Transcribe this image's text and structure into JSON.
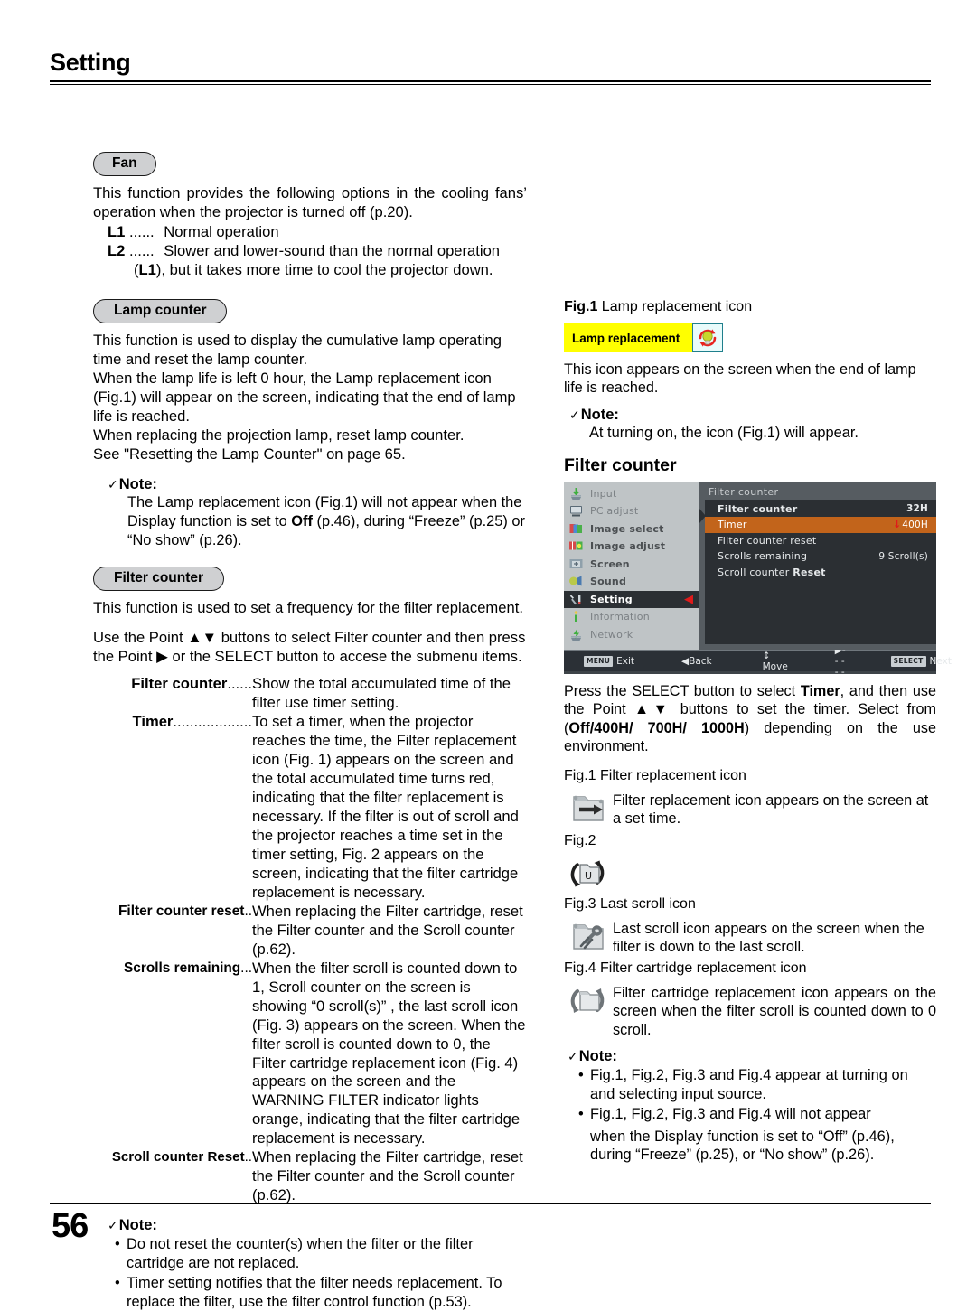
{
  "header": {
    "title": "Setting"
  },
  "footer": {
    "page_number": "56"
  },
  "left": {
    "fan": {
      "pill": "Fan",
      "intro": "This function provides the following options in the cooling fans’ operation when the projector is turned off (p.20).",
      "options": [
        {
          "key": "L1",
          "dots": "......",
          "desc": "Normal operation"
        },
        {
          "key": "L2",
          "dots": "......",
          "desc": "Slower and lower-sound than the normal operation",
          "desc2_pre": "(",
          "desc2_bold": "L1",
          "desc2_post": "), but it takes more time to cool the projector down."
        }
      ]
    },
    "lamp_counter": {
      "pill": "Lamp counter",
      "para1": "This function is used to display the cumulative lamp operating time and reset the lamp counter.",
      "para2": "When the lamp life is left 0 hour, the Lamp replacement icon (Fig.1) will appear on the screen, indicating that the end of lamp life is reached.",
      "para3": "When replacing the projection lamp, reset lamp counter.",
      "para4": "See \"Resetting the Lamp Counter\" on page 65.",
      "note_label": "Note:",
      "note_text_pre": "The Lamp replacement icon (Fig.1) will not appear when the Display function is set to ",
      "note_text_bold": "Off",
      "note_text_post": " (p.46), during “Freeze” (p.25) or “No show” (p.26)."
    },
    "filter_counter": {
      "pill": "Filter counter",
      "para1": "This function is used to set a frequency for the filter replacement.",
      "para2_a": "Use the Point ",
      "para2_arrows": "▲▼",
      "para2_b": " buttons to select Filter counter and then press the Point ",
      "para2_arrow_right": "▶",
      "para2_c": " or the SELECT button to accese the submenu items.",
      "definitions": [
        {
          "term": "Filter counter",
          "dots": "......",
          "desc": "Show the total accumulated time of the filter use timer setting."
        },
        {
          "term": "Timer",
          "dots": "...................",
          "desc": "To set a timer, when the projector reaches the time, the Filter replacement icon (Fig. 1) appears on the screen and the total accumulated time turns red, indicating that the filter replacement is necessary. If the filter is out of scroll and the projector reaches a time set in the timer setting, Fig. 2 appears on the screen, indicating that the filter cartridge replacement is necessary."
        },
        {
          "term": "Filter counter reset",
          "dots": "..",
          "desc": "When replacing the Filter cartridge, reset the Filter counter and the Scroll counter (p.62)."
        },
        {
          "term": "Scrolls remaining",
          "dots": "...",
          "desc": "When the filter scroll is counted down to 1, Scroll counter on the screen is showing “0 scroll(s)” , the last scroll icon (Fig. 3) appears on the screen. When the filter scroll is counted down to 0, the Filter cartridge replacement icon (Fig. 4) appears on the screen and the WARNING FILTER indicator lights orange, indicating that the filter cartridge replacement is necessary."
        },
        {
          "term": "Scroll counter Reset",
          "dots": "..",
          "desc": "When replacing the Filter cartridge, reset the Filter counter and the Scroll counter (p.62)."
        }
      ],
      "note_label": "Note:",
      "note_bullets": [
        "Do not reset the counter(s) when the filter or the filter cartridge are not replaced.",
        "Timer setting notifies that the filter needs replacement. To replace the filter, use the filter control function (p.53)."
      ]
    }
  },
  "right": {
    "fig1_lamp": {
      "label_bold": "Fig.1",
      "label_rest": "  Lamp replacement icon",
      "banner_text": "Lamp replacement",
      "banner_icon": "lamp-replacement-icon",
      "caption": "This icon appears on the screen when the end of lamp life is reached.",
      "note_label": "Note:",
      "note_text": "At turning on, the icon (Fig.1) will appear."
    },
    "filter_counter_section": {
      "title": "Filter counter",
      "osd": {
        "sidebar": [
          {
            "label": "Input",
            "icon": "input-icon",
            "state": "dim"
          },
          {
            "label": "PC adjust",
            "icon": "pc-adjust-icon",
            "state": "dim"
          },
          {
            "label": "Image select",
            "icon": "image-select-icon",
            "state": "bright"
          },
          {
            "label": "Image adjust",
            "icon": "image-adjust-icon",
            "state": "bright"
          },
          {
            "label": "Screen",
            "icon": "screen-icon",
            "state": "bright"
          },
          {
            "label": "Sound",
            "icon": "sound-icon",
            "state": "bright"
          },
          {
            "label": "Setting",
            "icon": "setting-icon",
            "state": "active"
          },
          {
            "label": "Information",
            "icon": "information-icon",
            "state": "dim"
          },
          {
            "label": "Network",
            "icon": "network-icon",
            "state": "dim"
          }
        ],
        "panel_title": "Filter counter",
        "rows": [
          {
            "name": "Filter counter",
            "value": "32H",
            "selected": false,
            "bold": true
          },
          {
            "name": "Timer",
            "value": "400H",
            "selected": true,
            "arrow": "↓"
          },
          {
            "name": "Filter  counter  reset",
            "value": "",
            "selected": false
          },
          {
            "name": "Scrolls remaining",
            "value": "9 Scroll(s)",
            "selected": false
          },
          {
            "name": "Scroll counter ",
            "name_bold": "Reset",
            "value": "",
            "selected": false
          }
        ],
        "bar": [
          {
            "key": "MENU",
            "label": "Exit"
          },
          {
            "key": "",
            "label": "◀Back"
          },
          {
            "key": "",
            "label": "↕ Move"
          },
          {
            "key": "",
            "label": "▶- - - - -"
          },
          {
            "key": "SELECT",
            "label": "Next"
          }
        ]
      },
      "instruction_a": "Press the SELECT button to select ",
      "instruction_timer": "Timer",
      "instruction_b": ", and then use the Point ",
      "instruction_arrows": "▲▼",
      "instruction_c": " buttons to set the timer. Select from (",
      "instruction_opts1": "Off/",
      "instruction_opts2": "400H/ 700H/ 1000H",
      "instruction_d": ") depending on the use environment."
    },
    "figures": [
      {
        "label": "Fig.1 Filter replacement icon",
        "icon": "filter-replacement-icon",
        "text": "Filter replacement icon appears on the screen at a set time."
      },
      {
        "label": "Fig.2",
        "icon": "filter-cartridge-u-icon",
        "text": ""
      },
      {
        "label": "Fig.3 Last scroll icon",
        "icon": "last-scroll-icon",
        "text": "Last scroll icon appears on the screen when the filter is down to the last scroll."
      },
      {
        "label": "Fig.4 Filter cartridge replacement icon",
        "icon": "filter-cartridge-replacement-icon",
        "text": "Filter cartridge replacement icon appears on the screen when the filter scroll is counted down to 0 scroll."
      }
    ],
    "final_note": {
      "note_label": "Note:",
      "bullets": [
        "Fig.1, Fig.2, Fig.3 and Fig.4 appear at turning on and selecting input source.",
        "Fig.1, Fig.2, Fig.3 and Fig.4 will not appear"
      ],
      "bullet2_cont": "when the Display function is set to “Off” (p.46), during “Freeze” (p.25), or “No show” (p.26)."
    }
  },
  "colors": {
    "pill_fill": "#cfd0d2",
    "osd_sidebar": "#bfc4c6",
    "osd_panel": "#2b2f33",
    "osd_highlight": "#c2641b",
    "banner_yellow": "#ffff00",
    "red_accent": "#e01b1b"
  }
}
